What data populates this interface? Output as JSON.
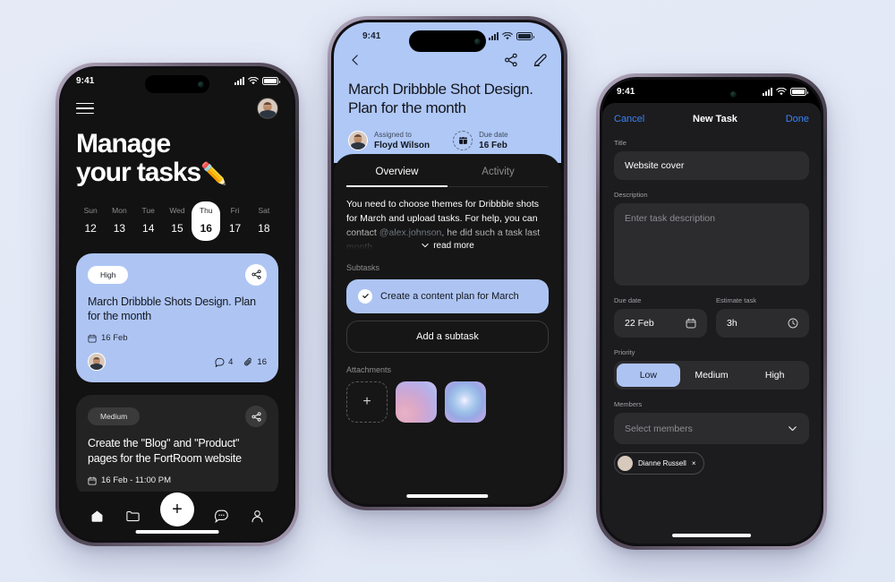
{
  "background_color": "#e3e9f6",
  "accent_blue": "#aec5f4",
  "ios_blue": "#3b82f6",
  "phone1": {
    "name": "task-list-screen",
    "status_bar": {
      "time": "9:41",
      "signal_icon": "cellular-bars-icon",
      "wifi_icon": "wifi-icon",
      "battery_icon": "battery-icon"
    },
    "menu_icon": "hamburger-menu-icon",
    "avatar": "user-avatar",
    "title_line1": "Manage",
    "title_line2": "your tasks",
    "title_emoji": "✏️",
    "calendar": [
      {
        "dow": "Sun",
        "num": "12",
        "active": false
      },
      {
        "dow": "Mon",
        "num": "13",
        "active": false
      },
      {
        "dow": "Tue",
        "num": "14",
        "active": false
      },
      {
        "dow": "Wed",
        "num": "15",
        "active": false
      },
      {
        "dow": "Thu",
        "num": "16",
        "active": true
      },
      {
        "dow": "Fri",
        "num": "17",
        "active": false
      },
      {
        "dow": "Sat",
        "num": "18",
        "active": false
      }
    ],
    "cards": [
      {
        "priority": "High",
        "title": "March Dribbble Shots Design. Plan for the month",
        "date": "16 Feb",
        "comments": "4",
        "attachments": "16",
        "theme": "blue"
      },
      {
        "priority": "Medium",
        "title": "Create the \"Blog\" and \"Product\" pages for the FortRoom website",
        "date": "16 Feb - 11:00 PM",
        "theme": "dark"
      }
    ],
    "nav": [
      {
        "icon": "home-icon",
        "label": "Home"
      },
      {
        "icon": "folder-icon",
        "label": "Projects"
      },
      {
        "icon": "plus-icon",
        "label": "Add"
      },
      {
        "icon": "chat-icon",
        "label": "Messages"
      },
      {
        "icon": "profile-icon",
        "label": "Profile"
      }
    ]
  },
  "phone2": {
    "name": "task-detail-screen",
    "status_bar": {
      "time": "9:41"
    },
    "back_icon": "chevron-left-icon",
    "share_icon": "share-icon",
    "edit_icon": "pencil-icon",
    "title": "March Dribbble Shot Design. Plan for the month",
    "assigned_label": "Assigned to",
    "assigned_value": "Floyd Wilson",
    "due_label": "Due date",
    "due_value": "16 Feb",
    "tabs": [
      {
        "label": "Overview",
        "active": true
      },
      {
        "label": "Activity",
        "active": false
      }
    ],
    "description_p1": "You need to choose themes for Dribbble shots for March and upload tasks. For help, you can contact ",
    "description_mention": "@alex.johnson",
    "description_p2": ", he did such a task last month",
    "read_more": "read more",
    "subtasks_label": "Subtasks",
    "subtask_done": "Create a content plan for March",
    "subtask_add": "Add a subtask",
    "attachments_label": "Attachments",
    "attachment_add_icon": "plus-icon"
  },
  "phone3": {
    "name": "new-task-form-screen",
    "status_bar": {
      "time": "9:41"
    },
    "cancel": "Cancel",
    "header_title": "New Task",
    "done": "Done",
    "title_label": "Title",
    "title_value": "Website cover",
    "description_label": "Description",
    "description_placeholder": "Enter task description",
    "due_date_label": "Due date",
    "due_date_value": "22 Feb",
    "due_date_icon": "calendar-icon",
    "estimate_label": "Estimate task",
    "estimate_value": "3h",
    "estimate_icon": "clock-icon",
    "priority_label": "Priority",
    "priority_options": [
      {
        "label": "Low",
        "active": true
      },
      {
        "label": "Medium",
        "active": false
      },
      {
        "label": "High",
        "active": false
      }
    ],
    "members_label": "Members",
    "members_placeholder": "Select members",
    "members_chevron": "chevron-down-icon",
    "member_chip_name": "Dianne Russell",
    "member_chip_remove": "×"
  }
}
